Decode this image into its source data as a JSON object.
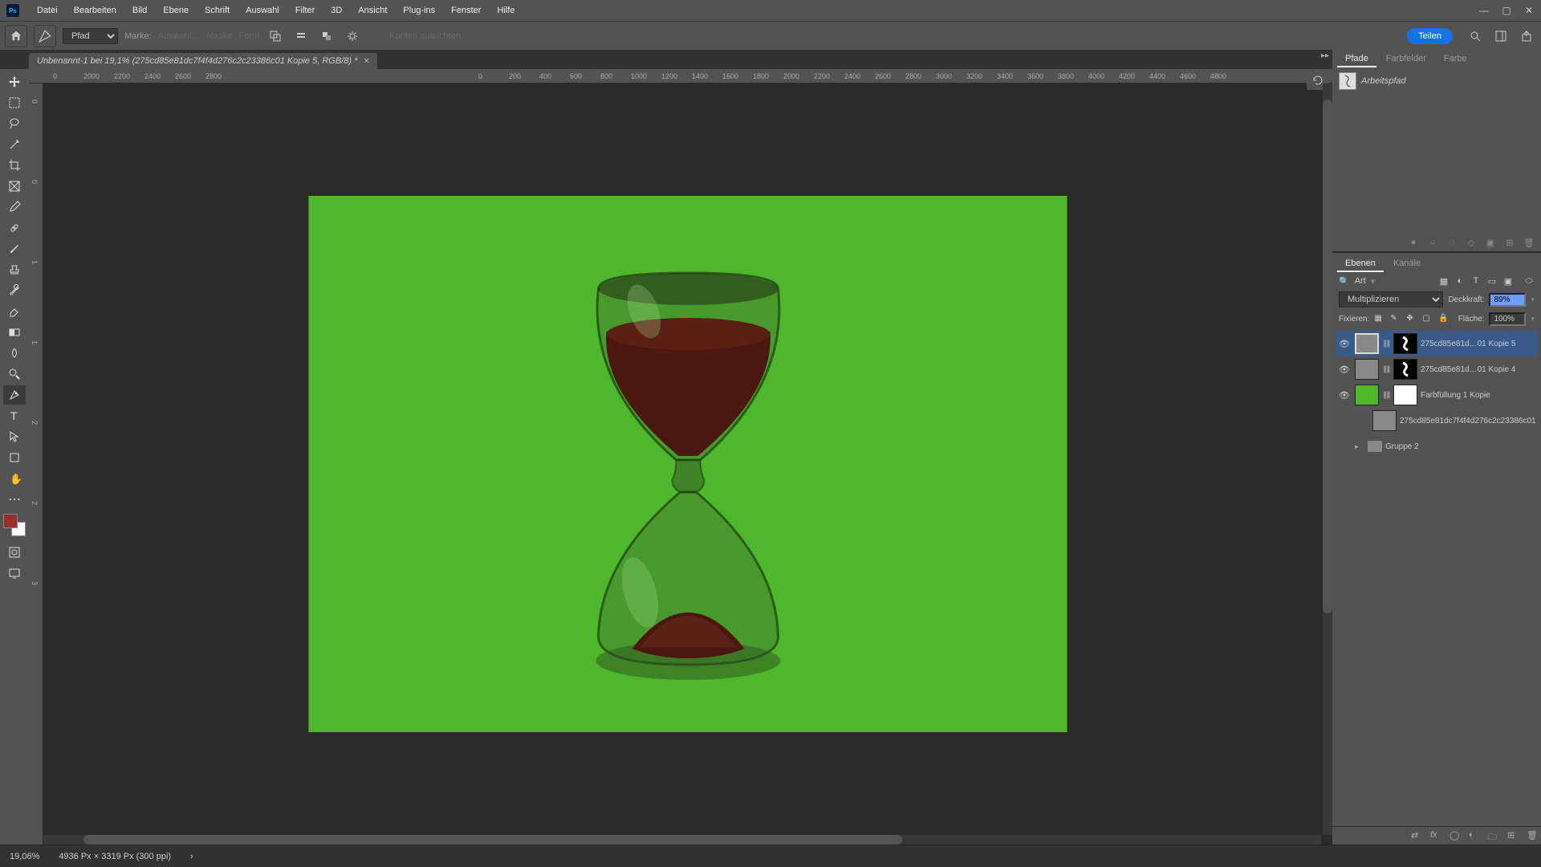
{
  "menu": [
    "Datei",
    "Bearbeiten",
    "Bild",
    "Ebene",
    "Schrift",
    "Auswahl",
    "Filter",
    "3D",
    "Ansicht",
    "Plug-ins",
    "Fenster",
    "Hilfe"
  ],
  "options": {
    "mode_label": "Pfad",
    "make_label": "Marke:",
    "selection_label": "Auswahl…",
    "mask_label": "Maske",
    "shape_label": "Form",
    "edge_label": "Kanten ausrichten"
  },
  "share_label": "Teilen",
  "doc_tab": "Unbenannt-1 bei 19,1% (275cd85e81dc7f4f4d276c2c23386c01 Kopie 5, RGB/8) *",
  "ruler_ticks": [
    "0",
    "2000",
    "2200",
    "2400",
    "2600",
    "2800",
    "0",
    "200",
    "400",
    "600",
    "800",
    "1000",
    "1200",
    "1400",
    "1600",
    "1800",
    "2000",
    "2200",
    "2400",
    "2600",
    "2800",
    "3000",
    "3200",
    "3400",
    "3600",
    "3800",
    "4000",
    "4200",
    "4400",
    "4600",
    "4800"
  ],
  "ruler_v_ticks": [
    "0",
    "0",
    "1",
    "1",
    "2",
    "2",
    "3"
  ],
  "paths_tabs": [
    "Pfade",
    "Farbfelder",
    "Farbe"
  ],
  "path_name": "Arbeitspfad",
  "layers_tabs": [
    "Ebenen",
    "Kanäle"
  ],
  "filter_label": "Art",
  "blend_mode": "Multiplizieren",
  "opacity_label": "Deckkraft:",
  "opacity_value": "89%",
  "lock_label": "Fixieren:",
  "fill_label": "Fläche:",
  "fill_value": "100%",
  "layers": [
    {
      "name": "275cd85e81d…01 Kopie 5",
      "eye": true,
      "masked": true,
      "sel": true,
      "thumb": "img"
    },
    {
      "name": "275cd85e81d…01 Kopie 4",
      "eye": true,
      "masked": true,
      "sel": false,
      "thumb": "img"
    },
    {
      "name": "Farbfüllung 1 Kopie",
      "eye": true,
      "masked": true,
      "sel": false,
      "thumb": "fill"
    },
    {
      "name": "275cd85e81dc7f4f4d276c2c23386c01",
      "eye": false,
      "masked": false,
      "sel": false,
      "thumb": "img"
    },
    {
      "name": "Gruppe 2",
      "eye": false,
      "masked": false,
      "sel": false,
      "thumb": "folder"
    }
  ],
  "status": {
    "zoom": "19,06%",
    "dims": "4936 Px × 3319 Px (300 ppi)"
  },
  "canvas": {
    "bg": "#4fb72e"
  }
}
